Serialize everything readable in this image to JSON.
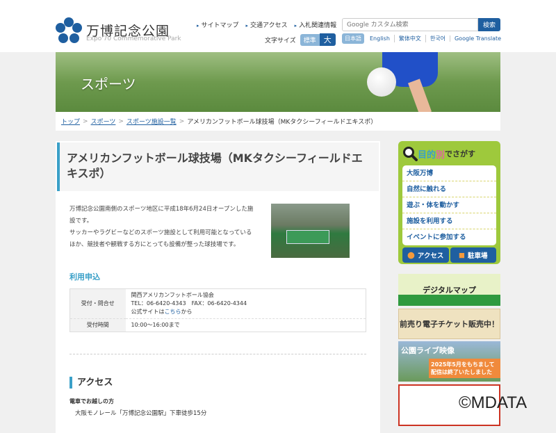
{
  "header": {
    "logo_title": "万博記念公園",
    "logo_sub": "Expo'70 Commemorative Park",
    "links": [
      "サイトマップ",
      "交通アクセス",
      "入札関連情報"
    ],
    "font_size_label": "文字サイズ",
    "font_std": "標準",
    "font_big": "大",
    "search_placeholder": "Google カスタム検索",
    "search_button": "検索",
    "langs": [
      "日本語",
      "English",
      "繁体中文",
      "한국어",
      "Google Translate"
    ]
  },
  "hero": {
    "title": "スポーツ"
  },
  "breadcrumb": [
    "トップ",
    "スポーツ",
    "スポーツ施設一覧",
    "アメリカンフットボール球技場（MKタクシーフィールドエキスポ）"
  ],
  "main": {
    "title": "アメリカンフットボール球技場（MKタクシーフィールドエキスポ）",
    "desc": [
      "万博記念公園南側のスポーツ地区に平成18年6月24日オープンした施設です。",
      "サッカーやラグビーなどのスポーツ施設として利用可能となっているほか、競技者や観戦する方にとっても設備が整った球技場です。"
    ],
    "apply_heading": "利用申込",
    "table": {
      "row1_label": "受付・問合せ",
      "org": "関西アメリカンフットボール協会",
      "tel": "TEL：06-6420-4343　FAX：06-6420-4344",
      "site_pre": "公式サイトは",
      "site_link": "こちら",
      "site_post": "から",
      "row2_label": "受付時間",
      "hours": "10:00〜16:00まで"
    },
    "access_heading": "アクセス",
    "train_heading": "電車でお越しの方",
    "train_text": "大阪モノレール「万博記念公園駅」下車徒歩15分"
  },
  "sidebar": {
    "heading_1": "目",
    "heading_2": "的",
    "heading_3": "別",
    "heading_rest": "でさがす",
    "items": [
      "大阪万博",
      "自然に触れる",
      "遊ぶ・体を動かす",
      "施設を利用する",
      "イベントに参加する"
    ],
    "access": "アクセス",
    "parking": "駐車場",
    "banner1": "デジタルマップ",
    "banner2": "前売り電子チケット販売中！",
    "banner3": "公園ライブ映像",
    "banner3_note": "2025年5月をもちまして配信は終了いたしました"
  },
  "watermark": "©MDATA"
}
